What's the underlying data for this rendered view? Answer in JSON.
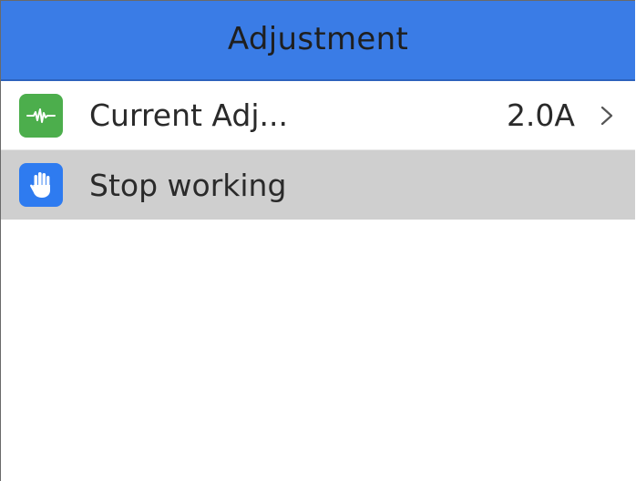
{
  "header": {
    "title": "Adjustment",
    "color": "#3a7ce6"
  },
  "items": [
    {
      "label": "Current Adj...",
      "value": "2.0A",
      "icon": "waveform-icon",
      "icon_color": "#4cae4c",
      "chevron": "chevron-right-icon"
    },
    {
      "label": "Stop working",
      "icon": "hand-stop-icon",
      "icon_color": "#2e7bf0",
      "selected": true,
      "highlight_color": "#cfcfcf"
    }
  ]
}
